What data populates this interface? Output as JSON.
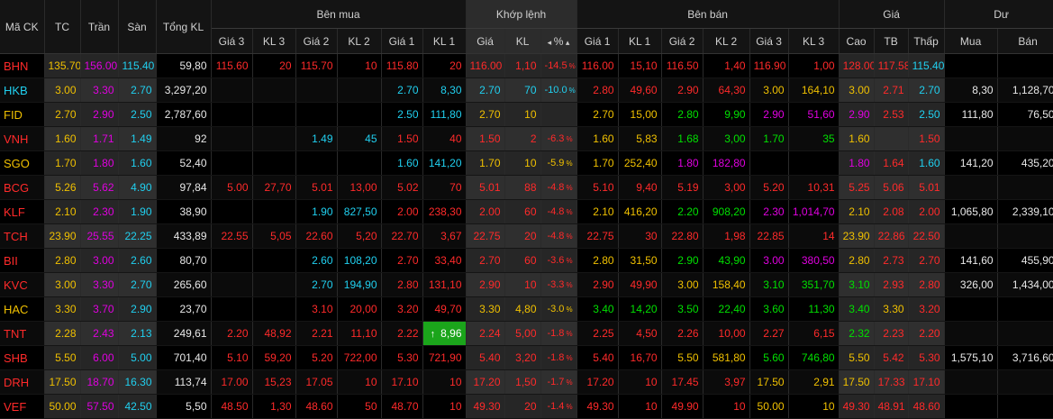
{
  "colors": {
    "up": "#00e000",
    "down": "#ff2a2a",
    "reference": "#f0c000",
    "ceiling": "#e000e0",
    "floor": "#20d0f0",
    "neutral": "#e8e8e8",
    "highlight": "#1ba51b"
  },
  "header": {
    "symbol": "Mã CK",
    "ref": "TC",
    "ceil": "Trần",
    "floor": "Sàn",
    "total_vol": "Tổng KL",
    "buy_group": "Bên mua",
    "match_group": "Khớp lệnh",
    "sell_group": "Bên bán",
    "price_group": "Giá",
    "rem_group": "Dư",
    "gia3": "Giá 3",
    "kl3": "KL 3",
    "gia2": "Giá 2",
    "kl2": "KL 2",
    "gia1": "Giá 1",
    "kl1": "KL 1",
    "m_gia": "Giá",
    "m_kl": "KL",
    "m_pct": "%",
    "high": "Cao",
    "avg": "TB",
    "low": "Thấp",
    "rem_buy": "Mua",
    "rem_sell": "Bán"
  },
  "rows": [
    {
      "sym": [
        "BHN",
        "dn"
      ],
      "tc": "135.70",
      "tran": "156.00",
      "san": "115.40",
      "tkl": "59,80",
      "b3": [
        "115.60",
        "dn"
      ],
      "bk3": [
        "20",
        "dn"
      ],
      "b2": [
        "115.70",
        "dn"
      ],
      "bk2": [
        "10",
        "dn"
      ],
      "b1": [
        "115.80",
        "dn"
      ],
      "bk1": [
        "20",
        "dn"
      ],
      "m": [
        "116.00",
        "dn"
      ],
      "mk": [
        "1,10",
        "dn"
      ],
      "mp": [
        "-14.5",
        "dn"
      ],
      "s1": [
        "116.00",
        "dn"
      ],
      "sk1": [
        "15,10",
        "dn"
      ],
      "s2": [
        "116.50",
        "dn"
      ],
      "sk2": [
        "1,40",
        "dn"
      ],
      "s3": [
        "116.90",
        "dn"
      ],
      "sk3": [
        "1,00",
        "dn"
      ],
      "hi": [
        "128.00",
        "dn"
      ],
      "av": [
        "117.58",
        "dn"
      ],
      "lo": [
        "115.40",
        "fl"
      ],
      "rb": "",
      "rs": ""
    },
    {
      "sym": [
        "HKB",
        "fl"
      ],
      "tc": "3.00",
      "tran": "3.30",
      "san": "2.70",
      "tkl": "3,297,20",
      "b3": [
        "",
        ""
      ],
      "bk3": [
        "",
        ""
      ],
      "b2": [
        "",
        ""
      ],
      "bk2": [
        "",
        ""
      ],
      "b1": [
        "2.70",
        "fl"
      ],
      "bk1": [
        "8,30",
        "fl"
      ],
      "m": [
        "2.70",
        "fl"
      ],
      "mk": [
        "70",
        "fl"
      ],
      "mp": [
        "-10.0",
        "fl"
      ],
      "s1": [
        "2.80",
        "dn"
      ],
      "sk1": [
        "49,60",
        "dn"
      ],
      "s2": [
        "2.90",
        "dn"
      ],
      "sk2": [
        "64,30",
        "dn"
      ],
      "s3": [
        "3.00",
        "rf"
      ],
      "sk3": [
        "164,10",
        "rf"
      ],
      "hi": [
        "3.00",
        "rf"
      ],
      "av": [
        "2.71",
        "dn"
      ],
      "lo": [
        "2.70",
        "fl"
      ],
      "rb": "8,30",
      "rs": "1,128,70"
    },
    {
      "sym": [
        "FID",
        "rf"
      ],
      "tc": "2.70",
      "tran": "2.90",
      "san": "2.50",
      "tkl": "2,787,60",
      "b3": [
        "",
        ""
      ],
      "bk3": [
        "",
        ""
      ],
      "b2": [
        "",
        ""
      ],
      "bk2": [
        "",
        ""
      ],
      "b1": [
        "2.50",
        "fl"
      ],
      "bk1": [
        "111,80",
        "fl"
      ],
      "m": [
        "2.70",
        "rf"
      ],
      "mk": [
        "10",
        "rf"
      ],
      "mp": [
        "",
        ""
      ],
      "s1": [
        "2.70",
        "rf"
      ],
      "sk1": [
        "15,00",
        "rf"
      ],
      "s2": [
        "2.80",
        "up"
      ],
      "sk2": [
        "9,90",
        "up"
      ],
      "s3": [
        "2.90",
        "ce"
      ],
      "sk3": [
        "51,60",
        "ce"
      ],
      "hi": [
        "2.90",
        "ce"
      ],
      "av": [
        "2.53",
        "dn"
      ],
      "lo": [
        "2.50",
        "fl"
      ],
      "rb": "111,80",
      "rs": "76,50"
    },
    {
      "sym": [
        "VNH",
        "dn"
      ],
      "tc": "1.60",
      "tran": "1.71",
      "san": "1.49",
      "tkl": "92",
      "b3": [
        "",
        ""
      ],
      "bk3": [
        "",
        ""
      ],
      "b2": [
        "1.49",
        "fl"
      ],
      "bk2": [
        "45",
        "fl"
      ],
      "b1": [
        "1.50",
        "dn"
      ],
      "bk1": [
        "40",
        "dn"
      ],
      "m": [
        "1.50",
        "dn"
      ],
      "mk": [
        "2",
        "dn"
      ],
      "mp": [
        "-6.3",
        "dn"
      ],
      "s1": [
        "1.60",
        "rf"
      ],
      "sk1": [
        "5,83",
        "rf"
      ],
      "s2": [
        "1.68",
        "up"
      ],
      "sk2": [
        "3,00",
        "up"
      ],
      "s3": [
        "1.70",
        "up"
      ],
      "sk3": [
        "35",
        "up"
      ],
      "hi": [
        "1.60",
        "rf"
      ],
      "av": [
        "",
        ""
      ],
      "lo": [
        "1.50",
        "dn"
      ],
      "rb": "",
      "rs": ""
    },
    {
      "sym": [
        "SGO",
        "rf"
      ],
      "tc": "1.70",
      "tran": "1.80",
      "san": "1.60",
      "tkl": "52,40",
      "b3": [
        "",
        ""
      ],
      "bk3": [
        "",
        ""
      ],
      "b2": [
        "",
        ""
      ],
      "bk2": [
        "",
        ""
      ],
      "b1": [
        "1.60",
        "fl"
      ],
      "bk1": [
        "141,20",
        "fl"
      ],
      "m": [
        "1.70",
        "rf"
      ],
      "mk": [
        "10",
        "rf"
      ],
      "mp": [
        "-5.9",
        "rf"
      ],
      "s1": [
        "1.70",
        "rf"
      ],
      "sk1": [
        "252,40",
        "rf"
      ],
      "s2": [
        "1.80",
        "ce"
      ],
      "sk2": [
        "182,80",
        "ce"
      ],
      "s3": [
        "",
        ""
      ],
      "sk3": [
        "",
        ""
      ],
      "hi": [
        "1.80",
        "ce"
      ],
      "av": [
        "1.64",
        "dn"
      ],
      "lo": [
        "1.60",
        "fl"
      ],
      "rb": "141,20",
      "rs": "435,20"
    },
    {
      "sym": [
        "BCG",
        "dn"
      ],
      "tc": "5.26",
      "tran": "5.62",
      "san": "4.90",
      "tkl": "97,84",
      "b3": [
        "5.00",
        "dn"
      ],
      "bk3": [
        "27,70",
        "dn"
      ],
      "b2": [
        "5.01",
        "dn"
      ],
      "bk2": [
        "13,00",
        "dn"
      ],
      "b1": [
        "5.02",
        "dn"
      ],
      "bk1": [
        "70",
        "dn"
      ],
      "m": [
        "5.01",
        "dn"
      ],
      "mk": [
        "88",
        "dn"
      ],
      "mp": [
        "-4.8",
        "dn"
      ],
      "s1": [
        "5.10",
        "dn"
      ],
      "sk1": [
        "9,40",
        "dn"
      ],
      "s2": [
        "5.19",
        "dn"
      ],
      "sk2": [
        "3,00",
        "dn"
      ],
      "s3": [
        "5.20",
        "dn"
      ],
      "sk3": [
        "10,31",
        "dn"
      ],
      "hi": [
        "5.25",
        "dn"
      ],
      "av": [
        "5.06",
        "dn"
      ],
      "lo": [
        "5.01",
        "dn"
      ],
      "rb": "",
      "rs": ""
    },
    {
      "sym": [
        "KLF",
        "dn"
      ],
      "tc": "2.10",
      "tran": "2.30",
      "san": "1.90",
      "tkl": "38,90",
      "b3": [
        "",
        ""
      ],
      "bk3": [
        "",
        ""
      ],
      "b2": [
        "1.90",
        "fl"
      ],
      "bk2": [
        "827,50",
        "fl"
      ],
      "b1": [
        "2.00",
        "dn"
      ],
      "bk1": [
        "238,30",
        "dn"
      ],
      "m": [
        "2.00",
        "dn"
      ],
      "mk": [
        "60",
        "dn"
      ],
      "mp": [
        "-4.8",
        "dn"
      ],
      "s1": [
        "2.10",
        "rf"
      ],
      "sk1": [
        "416,20",
        "rf"
      ],
      "s2": [
        "2.20",
        "up"
      ],
      "sk2": [
        "908,20",
        "up"
      ],
      "s3": [
        "2.30",
        "ce"
      ],
      "sk3": [
        "1,014,70",
        "ce"
      ],
      "hi": [
        "2.10",
        "rf"
      ],
      "av": [
        "2.08",
        "dn"
      ],
      "lo": [
        "2.00",
        "dn"
      ],
      "rb": "1,065,80",
      "rs": "2,339,10"
    },
    {
      "sym": [
        "TCH",
        "dn"
      ],
      "tc": "23.90",
      "tran": "25.55",
      "san": "22.25",
      "tkl": "433,89",
      "b3": [
        "22.55",
        "dn"
      ],
      "bk3": [
        "5,05",
        "dn"
      ],
      "b2": [
        "22.60",
        "dn"
      ],
      "bk2": [
        "5,20",
        "dn"
      ],
      "b1": [
        "22.70",
        "dn"
      ],
      "bk1": [
        "3,67",
        "dn"
      ],
      "m": [
        "22.75",
        "dn"
      ],
      "mk": [
        "20",
        "dn"
      ],
      "mp": [
        "-4.8",
        "dn"
      ],
      "s1": [
        "22.75",
        "dn"
      ],
      "sk1": [
        "30",
        "dn"
      ],
      "s2": [
        "22.80",
        "dn"
      ],
      "sk2": [
        "1,98",
        "dn"
      ],
      "s3": [
        "22.85",
        "dn"
      ],
      "sk3": [
        "14",
        "dn"
      ],
      "hi": [
        "23.90",
        "rf"
      ],
      "av": [
        "22.86",
        "dn"
      ],
      "lo": [
        "22.50",
        "dn"
      ],
      "rb": "",
      "rs": ""
    },
    {
      "sym": [
        "BII",
        "dn"
      ],
      "tc": "2.80",
      "tran": "3.00",
      "san": "2.60",
      "tkl": "80,70",
      "b3": [
        "",
        ""
      ],
      "bk3": [
        "",
        ""
      ],
      "b2": [
        "2.60",
        "fl"
      ],
      "bk2": [
        "108,20",
        "fl"
      ],
      "b1": [
        "2.70",
        "dn"
      ],
      "bk1": [
        "33,40",
        "dn"
      ],
      "m": [
        "2.70",
        "dn"
      ],
      "mk": [
        "60",
        "dn"
      ],
      "mp": [
        "-3.6",
        "dn"
      ],
      "s1": [
        "2.80",
        "rf"
      ],
      "sk1": [
        "31,50",
        "rf"
      ],
      "s2": [
        "2.90",
        "up"
      ],
      "sk2": [
        "43,90",
        "up"
      ],
      "s3": [
        "3.00",
        "ce"
      ],
      "sk3": [
        "380,50",
        "ce"
      ],
      "hi": [
        "2.80",
        "rf"
      ],
      "av": [
        "2.73",
        "dn"
      ],
      "lo": [
        "2.70",
        "dn"
      ],
      "rb": "141,60",
      "rs": "455,90"
    },
    {
      "sym": [
        "KVC",
        "dn"
      ],
      "tc": "3.00",
      "tran": "3.30",
      "san": "2.70",
      "tkl": "265,60",
      "b3": [
        "",
        ""
      ],
      "bk3": [
        "",
        ""
      ],
      "b2": [
        "2.70",
        "fl"
      ],
      "bk2": [
        "194,90",
        "fl"
      ],
      "b1": [
        "2.80",
        "dn"
      ],
      "bk1": [
        "131,10",
        "dn"
      ],
      "m": [
        "2.90",
        "dn"
      ],
      "mk": [
        "10",
        "dn"
      ],
      "mp": [
        "-3.3",
        "dn"
      ],
      "s1": [
        "2.90",
        "dn"
      ],
      "sk1": [
        "49,90",
        "dn"
      ],
      "s2": [
        "3.00",
        "rf"
      ],
      "sk2": [
        "158,40",
        "rf"
      ],
      "s3": [
        "3.10",
        "up"
      ],
      "sk3": [
        "351,70",
        "up"
      ],
      "hi": [
        "3.10",
        "up"
      ],
      "av": [
        "2.93",
        "dn"
      ],
      "lo": [
        "2.80",
        "dn"
      ],
      "rb": "326,00",
      "rs": "1,434,00"
    },
    {
      "sym": [
        "HAC",
        "rf"
      ],
      "tc": "3.30",
      "tran": "3.70",
      "san": "2.90",
      "tkl": "23,70",
      "b3": [
        "",
        ""
      ],
      "bk3": [
        "",
        ""
      ],
      "b2": [
        "3.10",
        "dn"
      ],
      "bk2": [
        "20,00",
        "dn"
      ],
      "b1": [
        "3.20",
        "dn"
      ],
      "bk1": [
        "49,70",
        "dn"
      ],
      "m": [
        "3.30",
        "rf"
      ],
      "mk": [
        "4,80",
        "rf"
      ],
      "mp": [
        "-3.0",
        "rf"
      ],
      "s1": [
        "3.40",
        "up"
      ],
      "sk1": [
        "14,20",
        "up"
      ],
      "s2": [
        "3.50",
        "up"
      ],
      "sk2": [
        "22,40",
        "up"
      ],
      "s3": [
        "3.60",
        "up"
      ],
      "sk3": [
        "11,30",
        "up"
      ],
      "hi": [
        "3.40",
        "up"
      ],
      "av": [
        "3.30",
        "rf"
      ],
      "lo": [
        "3.20",
        "dn"
      ],
      "rb": "",
      "rs": ""
    },
    {
      "sym": [
        "TNT",
        "dn"
      ],
      "tc": "2.28",
      "tran": "2.43",
      "san": "2.13",
      "tkl": "249,61",
      "b3": [
        "2.20",
        "dn"
      ],
      "bk3": [
        "48,92",
        "dn"
      ],
      "b2": [
        "2.21",
        "dn"
      ],
      "bk2": [
        "11,10",
        "dn"
      ],
      "b1": [
        "2.22",
        "dn"
      ],
      "bk1": [
        "8,96",
        "hl"
      ],
      "m": [
        "2.24",
        "dn"
      ],
      "mk": [
        "5,00",
        "dn"
      ],
      "mp": [
        "-1.8",
        "dn"
      ],
      "s1": [
        "2.25",
        "dn"
      ],
      "sk1": [
        "4,50",
        "dn"
      ],
      "s2": [
        "2.26",
        "dn"
      ],
      "sk2": [
        "10,00",
        "dn"
      ],
      "s3": [
        "2.27",
        "dn"
      ],
      "sk3": [
        "6,15",
        "dn"
      ],
      "hi": [
        "2.32",
        "up"
      ],
      "av": [
        "2.23",
        "dn"
      ],
      "lo": [
        "2.20",
        "dn"
      ],
      "rb": "",
      "rs": ""
    },
    {
      "sym": [
        "SHB",
        "dn"
      ],
      "tc": "5.50",
      "tran": "6.00",
      "san": "5.00",
      "tkl": "701,40",
      "b3": [
        "5.10",
        "dn"
      ],
      "bk3": [
        "59,20",
        "dn"
      ],
      "b2": [
        "5.20",
        "dn"
      ],
      "bk2": [
        "722,00",
        "dn"
      ],
      "b1": [
        "5.30",
        "dn"
      ],
      "bk1": [
        "721,90",
        "dn"
      ],
      "m": [
        "5.40",
        "dn"
      ],
      "mk": [
        "3,20",
        "dn"
      ],
      "mp": [
        "-1.8",
        "dn"
      ],
      "s1": [
        "5.40",
        "dn"
      ],
      "sk1": [
        "16,70",
        "dn"
      ],
      "s2": [
        "5.50",
        "rf"
      ],
      "sk2": [
        "581,80",
        "rf"
      ],
      "s3": [
        "5.60",
        "up"
      ],
      "sk3": [
        "746,80",
        "up"
      ],
      "hi": [
        "5.50",
        "rf"
      ],
      "av": [
        "5.42",
        "dn"
      ],
      "lo": [
        "5.30",
        "dn"
      ],
      "rb": "1,575,10",
      "rs": "3,716,60"
    },
    {
      "sym": [
        "DRH",
        "dn"
      ],
      "tc": "17.50",
      "tran": "18.70",
      "san": "16.30",
      "tkl": "113,74",
      "b3": [
        "17.00",
        "dn"
      ],
      "bk3": [
        "15,23",
        "dn"
      ],
      "b2": [
        "17.05",
        "dn"
      ],
      "bk2": [
        "10",
        "dn"
      ],
      "b1": [
        "17.10",
        "dn"
      ],
      "bk1": [
        "10",
        "dn"
      ],
      "m": [
        "17.20",
        "dn"
      ],
      "mk": [
        "1,50",
        "dn"
      ],
      "mp": [
        "-1.7",
        "dn"
      ],
      "s1": [
        "17.20",
        "dn"
      ],
      "sk1": [
        "10",
        "dn"
      ],
      "s2": [
        "17.45",
        "dn"
      ],
      "sk2": [
        "3,97",
        "dn"
      ],
      "s3": [
        "17.50",
        "rf"
      ],
      "sk3": [
        "2,91",
        "rf"
      ],
      "hi": [
        "17.50",
        "rf"
      ],
      "av": [
        "17.33",
        "dn"
      ],
      "lo": [
        "17.10",
        "dn"
      ],
      "rb": "",
      "rs": ""
    },
    {
      "sym": [
        "VEF",
        "dn"
      ],
      "tc": "50.00",
      "tran": "57.50",
      "san": "42.50",
      "tkl": "5,50",
      "b3": [
        "48.50",
        "dn"
      ],
      "bk3": [
        "1,30",
        "dn"
      ],
      "b2": [
        "48.60",
        "dn"
      ],
      "bk2": [
        "50",
        "dn"
      ],
      "b1": [
        "48.70",
        "dn"
      ],
      "bk1": [
        "10",
        "dn"
      ],
      "m": [
        "49.30",
        "dn"
      ],
      "mk": [
        "20",
        "dn"
      ],
      "mp": [
        "-1.4",
        "dn"
      ],
      "s1": [
        "49.30",
        "dn"
      ],
      "sk1": [
        "10",
        "dn"
      ],
      "s2": [
        "49.90",
        "dn"
      ],
      "sk2": [
        "10",
        "dn"
      ],
      "s3": [
        "50.00",
        "rf"
      ],
      "sk3": [
        "10",
        "rf"
      ],
      "hi": [
        "49.30",
        "dn"
      ],
      "av": [
        "48.91",
        "dn"
      ],
      "lo": [
        "48.60",
        "dn"
      ],
      "rb": "",
      "rs": ""
    }
  ]
}
